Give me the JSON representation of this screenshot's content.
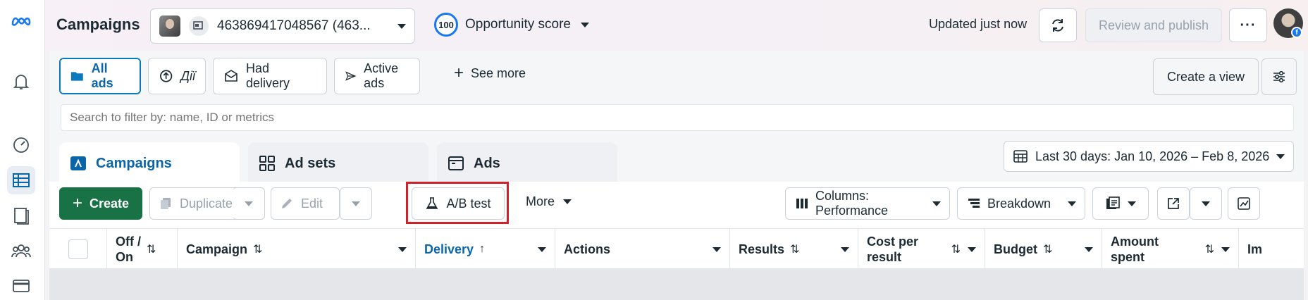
{
  "app": {
    "title": "Campaigns",
    "account": {
      "label": "463869417048567 (463..."
    },
    "opportunity": {
      "score": "100",
      "label": "Opportunity score"
    },
    "updated_text": "Updated just now",
    "review_button": "Review and publish",
    "more_button": "···"
  },
  "views": {
    "items": [
      {
        "label": "All ads",
        "icon": "folder-icon",
        "active": true
      },
      {
        "label": "Дії",
        "icon": "upload-circle-icon",
        "active": false
      },
      {
        "label": "Had delivery",
        "icon": "envelope-icon",
        "active": false
      },
      {
        "label": "Active ads",
        "icon": "send-icon",
        "active": false
      }
    ],
    "see_more": "See more",
    "create_view": "Create a view"
  },
  "search": {
    "placeholder": "Search to filter by: name, ID or metrics"
  },
  "tabs": [
    {
      "label": "Campaigns",
      "icon": "folder-icon",
      "active": true
    },
    {
      "label": "Ad sets",
      "icon": "grid-icon",
      "active": false
    },
    {
      "label": "Ads",
      "icon": "ad-window-icon",
      "active": false
    }
  ],
  "date_range": {
    "label": "Last 30 days: Jan 10, 2026 – Feb 8, 2026"
  },
  "toolbar": {
    "create": "Create",
    "duplicate": "Duplicate",
    "edit": "Edit",
    "ab_test": "A/B test",
    "more": "More",
    "columns": "Columns: Performance",
    "breakdown": "Breakdown"
  },
  "table": {
    "columns": [
      {
        "label_line1": "Off /",
        "label_line2": "On"
      },
      {
        "label": "Campaign"
      },
      {
        "label": "Delivery"
      },
      {
        "label": "Actions"
      },
      {
        "label": "Results"
      },
      {
        "label_line1": "Cost per",
        "label_line2": "result"
      },
      {
        "label": "Budget"
      },
      {
        "label_line1": "Amount",
        "label_line2": "spent"
      },
      {
        "label": "Im"
      }
    ]
  },
  "colors": {
    "accent_blue": "#0a66a8",
    "create_green": "#187245",
    "highlight_red": "#d0202a",
    "meta_blue": "#1877f2"
  }
}
